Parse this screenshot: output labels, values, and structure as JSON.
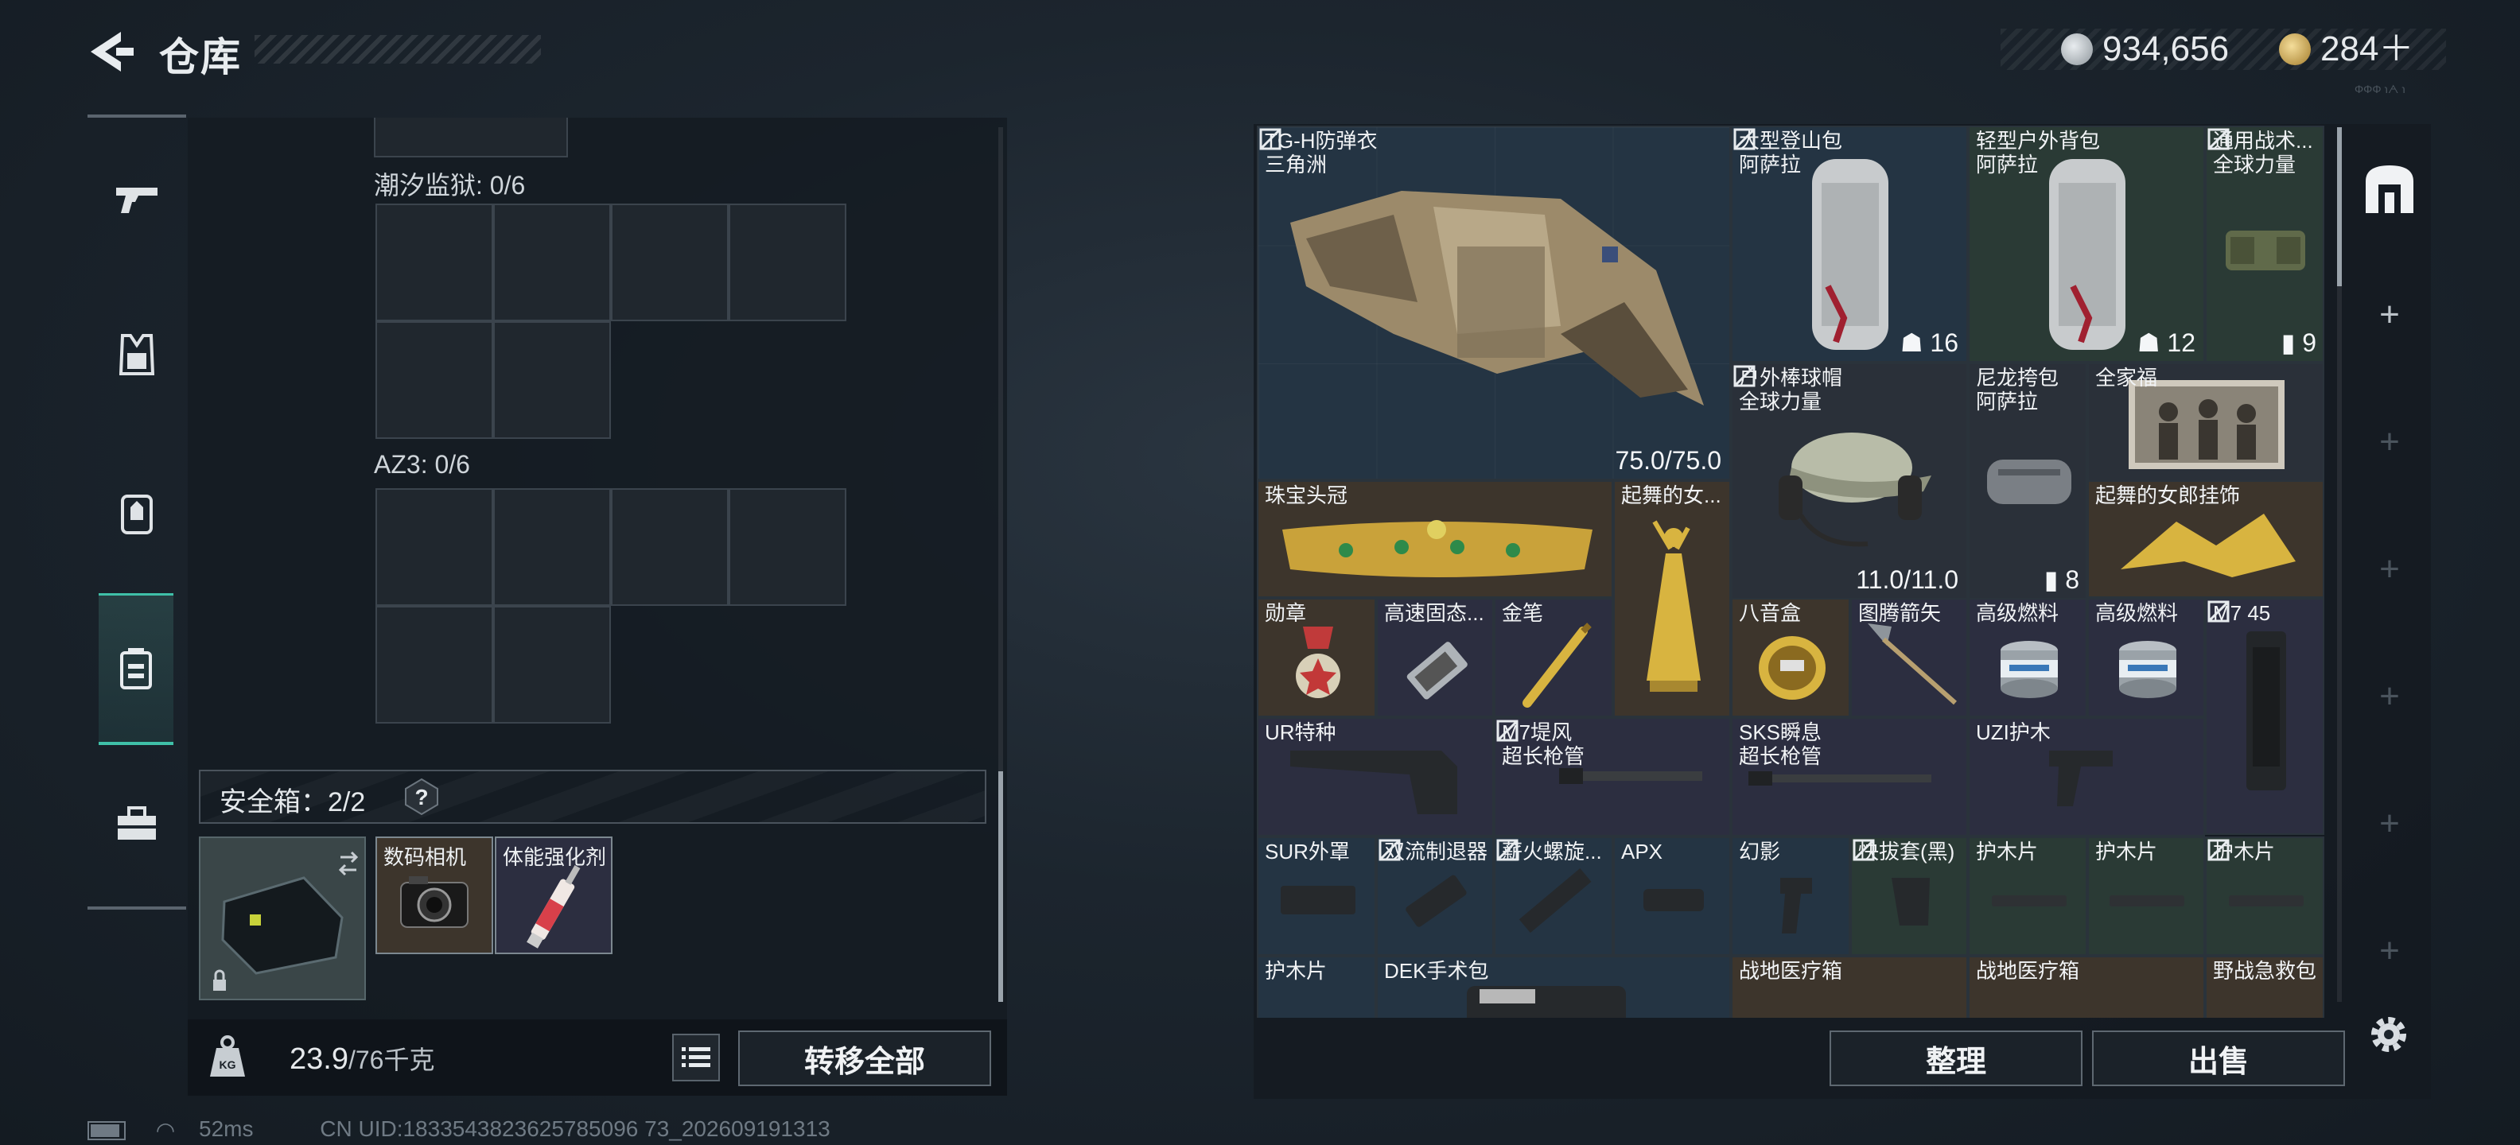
{
  "header": {
    "title": "仓库"
  },
  "currency": {
    "silver": "934,656",
    "gold": "284＋"
  },
  "top_deco": "ΦΦΦ ℩ᗅ ℩",
  "left_panel": {
    "container1_label": "潮汐监狱: 0/6",
    "container2_label": "AZ3: 0/6",
    "safe_box": {
      "label": "安全箱：2/2",
      "help": "?",
      "items": [
        {
          "name": "数码相机"
        },
        {
          "name": "体能强化剂"
        }
      ]
    },
    "weight": {
      "value": "23.9",
      "max": "/76千克"
    },
    "transfer_all": "转移全部"
  },
  "inventory": {
    "items": [
      {
        "name": "TG-H防弹衣",
        "sub": "三角洲",
        "durability": "75.0/75.0",
        "rarity": "blue"
      },
      {
        "name": "大型登山包",
        "sub": "阿萨拉",
        "count": "16",
        "rarity": "blue"
      },
      {
        "name": "轻型户外背包",
        "sub": "阿萨拉",
        "count": "12",
        "rarity": "green"
      },
      {
        "name": "通用战术...",
        "sub": "全球力量",
        "count": "9",
        "rarity": "green"
      },
      {
        "name": "户外棒球帽",
        "sub": "全球力量",
        "durability": "11.0/11.0",
        "rarity": "dark"
      },
      {
        "name": "尼龙挎包",
        "sub": "阿萨拉",
        "count": "8",
        "rarity": "dark"
      },
      {
        "name": "全家福",
        "rarity": "dark"
      },
      {
        "name": "珠宝头冠",
        "rarity": "brown"
      },
      {
        "name": "起舞的女...",
        "rarity": "brown"
      },
      {
        "name": "起舞的女郎挂饰",
        "rarity": "brown"
      },
      {
        "name": "勋章",
        "rarity": "brown"
      },
      {
        "name": "高速固态...",
        "rarity": "purple"
      },
      {
        "name": "金笔",
        "rarity": "purple"
      },
      {
        "name": "八音盒",
        "rarity": "brown"
      },
      {
        "name": "图腾箭矢",
        "rarity": "purple"
      },
      {
        "name": "高级燃料",
        "rarity": "purple"
      },
      {
        "name": "高级燃料",
        "rarity": "purple"
      },
      {
        "name": "M7 45",
        "rarity": "purple"
      },
      {
        "name": "UR特种",
        "rarity": "purple"
      },
      {
        "name": "M7堤风",
        "sub": "超长枪管",
        "rarity": "purple"
      },
      {
        "name": "SKS瞬息",
        "sub": "超长枪管",
        "rarity": "purple"
      },
      {
        "name": "UZI护木",
        "rarity": "purple"
      },
      {
        "name": "SUR外罩",
        "rarity": "blue"
      },
      {
        "name": "双流制退器",
        "rarity": "blue"
      },
      {
        "name": "薪火螺旋...",
        "rarity": "blue"
      },
      {
        "name": "APX",
        "rarity": "blue"
      },
      {
        "name": "幻影",
        "rarity": "blue"
      },
      {
        "name": "快拔套(黑)",
        "rarity": "green"
      },
      {
        "name": "护木片",
        "rarity": "green"
      },
      {
        "name": "护木片",
        "rarity": "green"
      },
      {
        "name": "护木片",
        "rarity": "green"
      },
      {
        "name": "护木片",
        "rarity": "blue"
      },
      {
        "name": "DEK手术包",
        "rarity": "blue"
      },
      {
        "name": "战地医疗箱",
        "rarity": "brown"
      },
      {
        "name": "战地医疗箱",
        "rarity": "brown"
      },
      {
        "name": "野战急救包",
        "rarity": "brown"
      }
    ]
  },
  "actions": {
    "sort": "整理",
    "sell": "出售"
  },
  "status": {
    "ping": "52ms",
    "uid": "CN UID:1833543823625785096 73_202609191313"
  },
  "colors": {
    "accent": "#3fc0a8",
    "panel": "#141b22"
  }
}
